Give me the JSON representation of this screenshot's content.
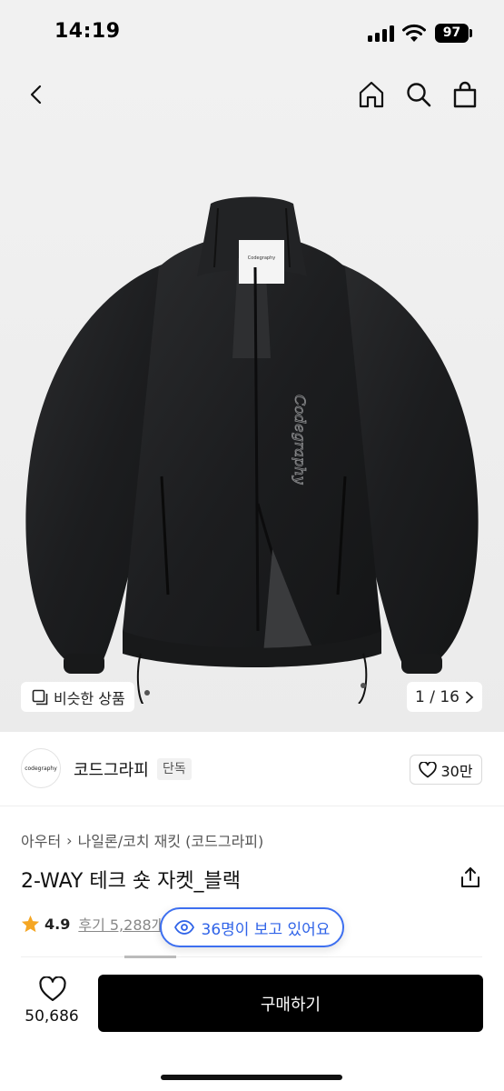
{
  "status_bar": {
    "time": "14:19",
    "battery": "97"
  },
  "hero": {
    "similar_label": "비슷한 상품",
    "page_indicator": "1 / 16",
    "garment_logo_text": "Codegraphy",
    "label_text": "Codegraphy"
  },
  "brand": {
    "logo_text": "codegraphy",
    "name": "코드그라피",
    "badge": "단독",
    "likes": "30만"
  },
  "product": {
    "category": [
      "아우터",
      "나일론/코치 재킷 (코드그라피)"
    ],
    "category_separator": "›",
    "title": "2-WAY 테크 숏 자켓_블랙",
    "rating": "4.9",
    "reviews": "후기 5,288개",
    "viewers": "36명이 보고 있어요"
  },
  "bottom_bar": {
    "wishlist_count": "50,686",
    "buy_label": "구매하기"
  },
  "colors": {
    "accent_blue": "#2f63e8",
    "star": "#f5a623",
    "buy_button": "#000000"
  },
  "icons": [
    "back-icon",
    "home-icon",
    "search-icon",
    "bag-icon",
    "similar-icon",
    "chevron-right-icon",
    "heart-icon",
    "share-icon",
    "star-icon",
    "eye-icon"
  ]
}
